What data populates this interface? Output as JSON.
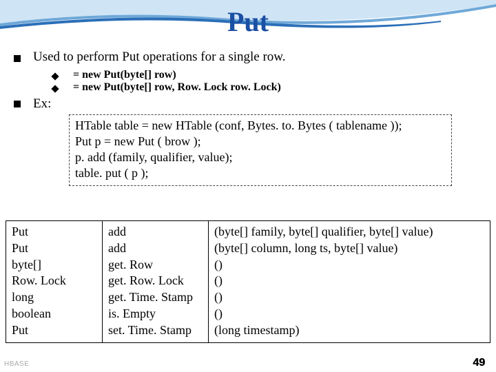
{
  "title": "Put",
  "bullet1": "Used to perform Put operations for a single row.",
  "sub1": "= new Put(byte[] row)",
  "sub2": "= new Put(byte[] row, Row. Lock row. Lock)",
  "bullet2_prefix": "Ex:",
  "code": [
    "HTable table = new HTable (conf, Bytes. to. Bytes ( tablename ));",
    "Put p = new Put ( brow );",
    "p. add (family, qualifier, value);",
    "table. put ( p );"
  ],
  "table": {
    "col1": [
      "Put",
      "Put",
      "byte[]",
      "Row. Lock",
      "long",
      "boolean",
      "Put"
    ],
    "col2": [
      "add",
      "add",
      "get. Row",
      "get. Row. Lock",
      "get. Time. Stamp",
      "is. Empty",
      "set. Time. Stamp"
    ],
    "col3": [
      "(byte[] family, byte[] qualifier,  byte[] value)",
      "(byte[] column, long ts, byte[] value)",
      "()",
      "()",
      "()",
      "()",
      "(long timestamp)"
    ]
  },
  "page_number": "49",
  "logo_text": "HBASE"
}
